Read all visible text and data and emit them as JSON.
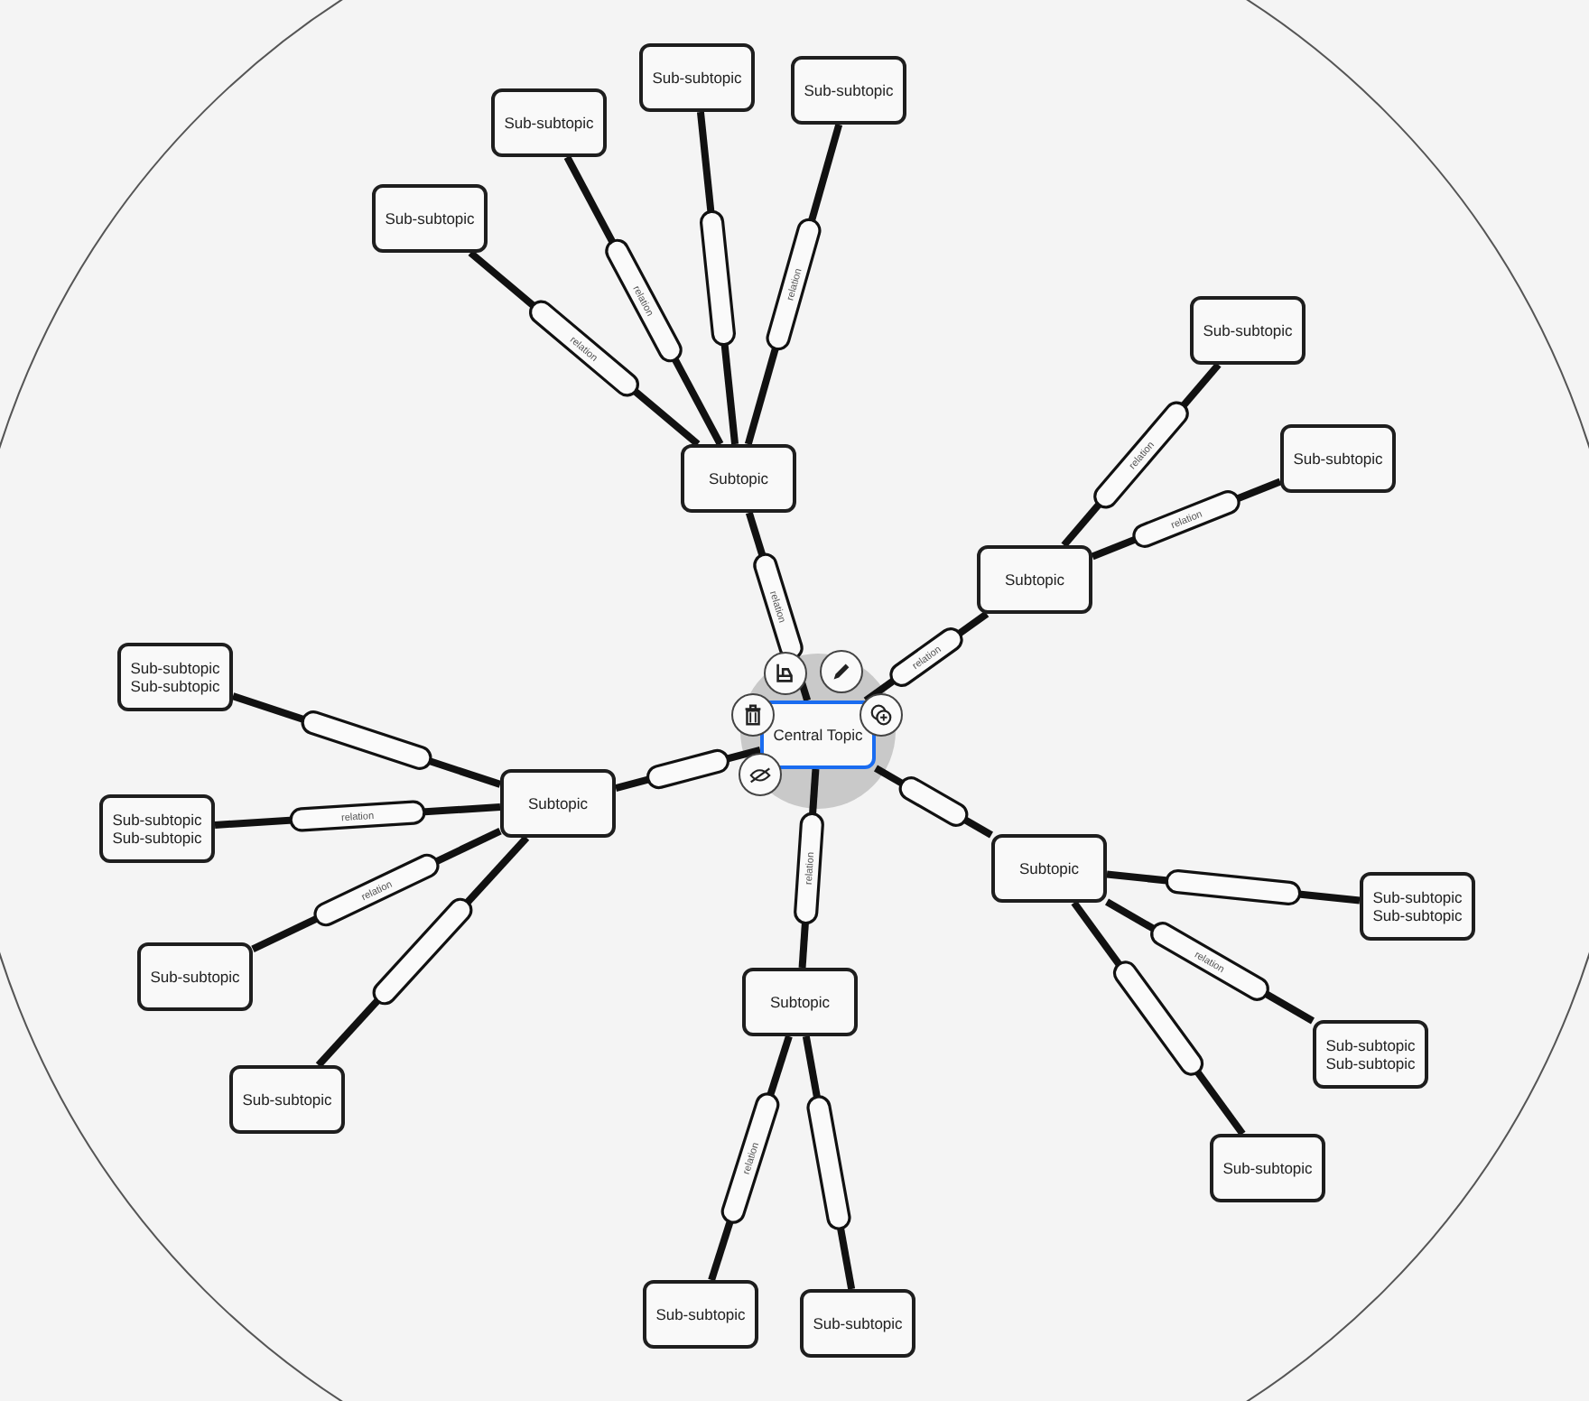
{
  "mind_map": {
    "central": {
      "label": "Central Topic",
      "selected": true
    },
    "subtopics": [
      {
        "label": "Subtopic",
        "relation": "relation",
        "children": [
          {
            "label": "Sub-subtopic",
            "relation": "relation"
          },
          {
            "label": "Sub-subtopic",
            "relation": "relation"
          },
          {
            "label": "Sub-subtopic"
          },
          {
            "label": "Sub-subtopic",
            "relation": "relation"
          }
        ]
      },
      {
        "label": "Subtopic",
        "relation": "relation",
        "children": [
          {
            "label": "Sub-subtopic",
            "relation": "relation"
          },
          {
            "label": "Sub-subtopic",
            "relation": "relation"
          }
        ]
      },
      {
        "label": "Subtopic",
        "children": [
          {
            "label": "Sub-subtopic\nSub-subtopic"
          },
          {
            "label": "Sub-subtopic\nSub-subtopic",
            "relation": "relation"
          },
          {
            "label": "Sub-subtopic",
            "relation": "relation"
          },
          {
            "label": "Sub-subtopic"
          }
        ]
      },
      {
        "label": "Subtopic",
        "children": [
          {
            "label": "Sub-subtopic\nSub-subtopic"
          },
          {
            "label": "Sub-subtopic\nSub-subtopic",
            "relation": "relation"
          },
          {
            "label": "Sub-subtopic"
          }
        ]
      },
      {
        "label": "Subtopic",
        "relation": "relation",
        "children": [
          {
            "label": "Sub-subtopic",
            "relation": "relation"
          },
          {
            "label": "Sub-subtopic"
          }
        ]
      }
    ]
  }
}
